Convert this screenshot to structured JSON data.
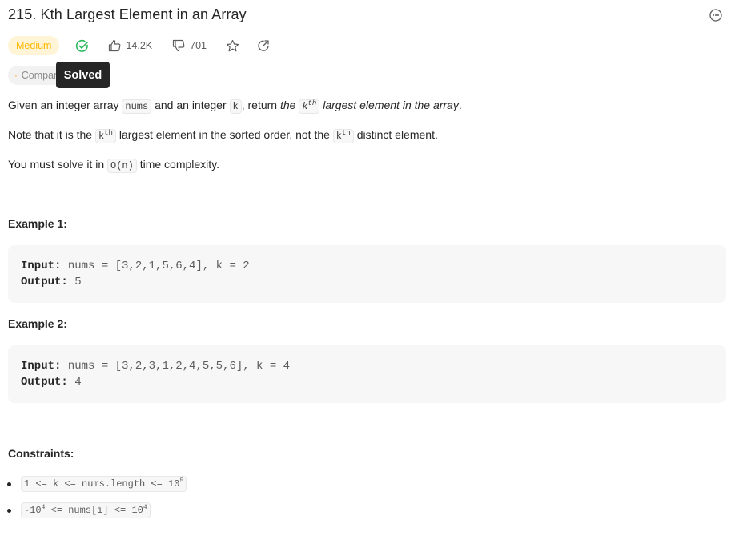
{
  "problem": {
    "title": "215. Kth Largest Element in an Array",
    "difficulty": "Medium",
    "likes": "14.2K",
    "dislikes": "701",
    "companies_label": "Companies",
    "tooltip": "Solved"
  },
  "description": {
    "p1": {
      "a": "Given an integer array ",
      "code1": "nums",
      "b": " and an integer ",
      "code2": "k",
      "c": ", return ",
      "d": "the ",
      "code3": "k",
      "sup": "th",
      "e": " largest element in the array",
      "f": "."
    },
    "p2": {
      "a": "Note that it is the ",
      "code1": "k",
      "sup1": "th",
      "b": " largest element in the sorted order, not the ",
      "code2": "k",
      "sup2": "th",
      "c": " distinct element."
    },
    "p3": {
      "a": "You must solve it in ",
      "code": "O(n)",
      "b": " time complexity."
    }
  },
  "examples": [
    {
      "heading": "Example 1:",
      "input_label": "Input:",
      "input": " nums = [3,2,1,5,6,4], k = 2",
      "output_label": "Output:",
      "output": " 5"
    },
    {
      "heading": "Example 2:",
      "input_label": "Input:",
      "input": " nums = [3,2,3,1,2,4,5,5,6], k = 4",
      "output_label": "Output:",
      "output": " 4"
    }
  ],
  "constraints": {
    "heading": "Constraints:",
    "c1": {
      "text": "1 <= k <= nums.length <= 10",
      "sup": "5"
    },
    "c2": {
      "a": "-10",
      "sup1": "4",
      "b": " <= nums[i] <= 10",
      "sup2": "4"
    }
  },
  "colors": {
    "medium": "#ffb800",
    "solved": "#2cbb5d",
    "lock": "#ffa116"
  }
}
